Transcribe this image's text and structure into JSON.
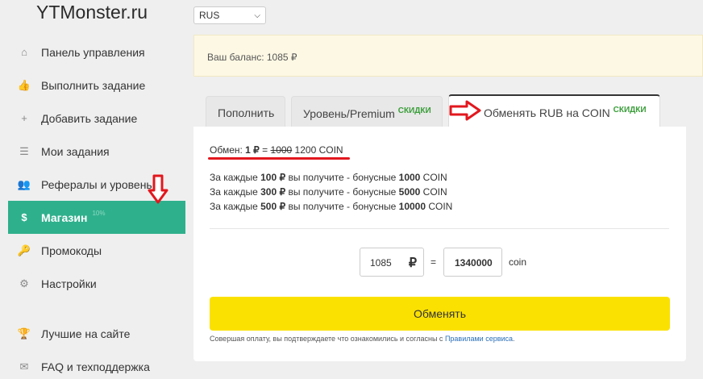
{
  "app": {
    "logo": "YTMonster.ru",
    "lang": "RUS"
  },
  "sidebar": {
    "items": [
      {
        "icon": "home-icon",
        "glyph": "⌂",
        "label": "Панель управления"
      },
      {
        "icon": "thumbs-up-icon",
        "glyph": "👍",
        "label": "Выполнить задание"
      },
      {
        "icon": "plus-icon",
        "glyph": "+",
        "label": "Добавить задание"
      },
      {
        "icon": "list-icon",
        "glyph": "☰",
        "label": "Мои задания"
      },
      {
        "icon": "users-icon",
        "glyph": "👥",
        "label": "Рефералы и уровень"
      },
      {
        "icon": "dollar-icon",
        "glyph": "$",
        "label": "Магазин",
        "badge": "10%"
      },
      {
        "icon": "key-icon",
        "glyph": "🔑",
        "label": "Промокоды"
      },
      {
        "icon": "gear-icon",
        "glyph": "⚙",
        "label": "Настройки"
      },
      {
        "icon": "trophy-icon",
        "glyph": "🏆",
        "label": "Лучшие на сайте"
      },
      {
        "icon": "envelope-icon",
        "glyph": "✉",
        "label": "FAQ и техподдержка"
      }
    ]
  },
  "balance": {
    "text": "Ваш баланс: 1085 ₽"
  },
  "tabs": {
    "t1": "Пополнить",
    "t2": "Уровень/Premium",
    "t2_badge": "СКИДКИ",
    "t3": "Обменять RUB на COIN",
    "t3_badge": "СКИДКИ"
  },
  "exchange": {
    "prefix": "Обмен: ",
    "one": "1 ₽",
    "eq": " = ",
    "old": "1000",
    "new": " 1200 COIN",
    "bonus": [
      {
        "pre": "За каждые ",
        "amt": "100 ₽",
        "mid": " вы получите - бонусные ",
        "coin": "1000",
        "post": " COIN"
      },
      {
        "pre": "За каждые ",
        "amt": "300 ₽",
        "mid": " вы получите - бонусные ",
        "coin": "5000",
        "post": " COIN"
      },
      {
        "pre": "За каждые ",
        "amt": "500 ₽",
        "mid": " вы получите - бонусные ",
        "coin": "10000",
        "post": " COIN"
      }
    ]
  },
  "calc": {
    "rub_value": "1085",
    "rub_symbol": "₽",
    "equals": "=",
    "coin_value": "1340000",
    "coin_label": "coin"
  },
  "action": {
    "button": "Обменять",
    "note": "Совершая оплату, вы подтверждаете что ознакомились и согласны с ",
    "link": "Правилами сервиса",
    "note_end": "."
  },
  "colors": {
    "accent": "#2fb08d",
    "button": "#fbe102",
    "highlight": "#e2171e"
  }
}
